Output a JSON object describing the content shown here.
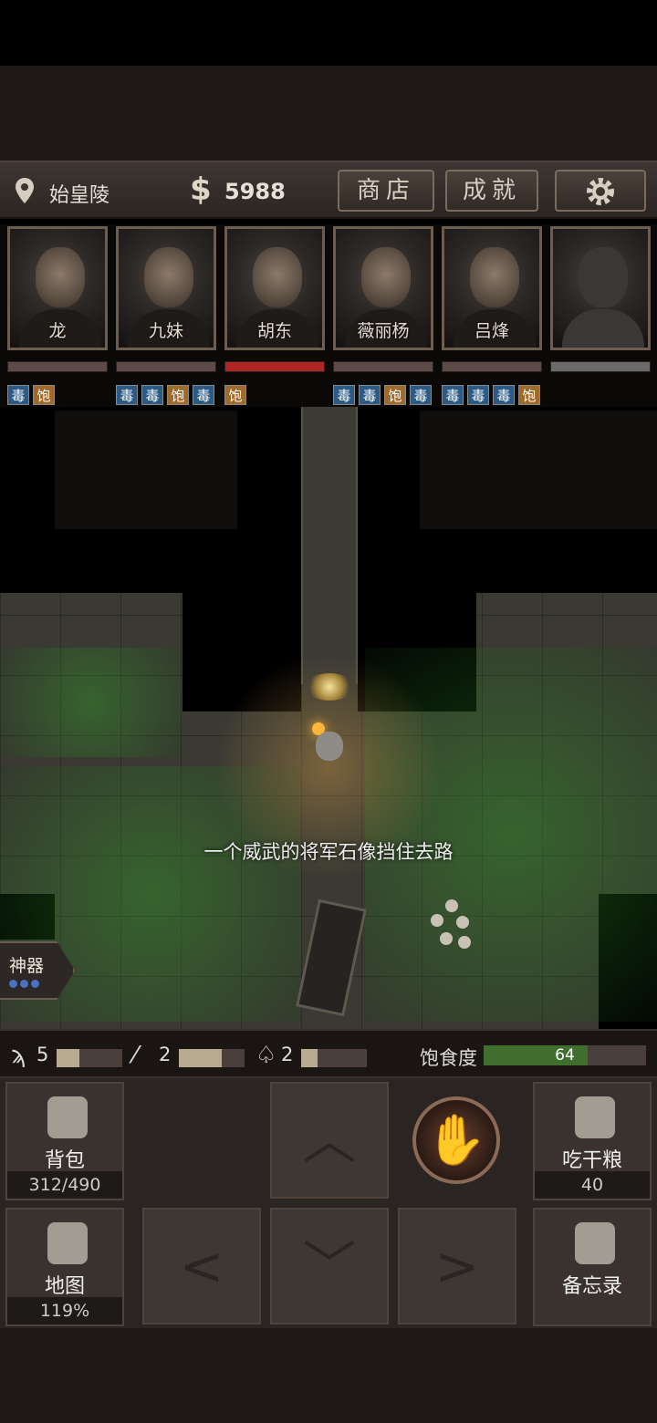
{
  "header": {
    "location": "始皇陵",
    "currency_symbol": "$",
    "money": "5988",
    "shop_label": "商店",
    "achievements_label": "成就"
  },
  "party": [
    {
      "name": "龙",
      "hp_color": "#5b4a48",
      "badges": [
        {
          "text": "毒",
          "kind": "poison"
        },
        {
          "text": "饱",
          "kind": "full"
        }
      ]
    },
    {
      "name": "九妹",
      "hp_color": "#5b4a48",
      "badges": [
        {
          "text": "毒",
          "kind": "poison"
        },
        {
          "text": "毒",
          "kind": "poison"
        },
        {
          "text": "饱",
          "kind": "full"
        },
        {
          "text": "毒",
          "kind": "poison"
        }
      ]
    },
    {
      "name": "胡东",
      "hp_color": "#b02424",
      "badges": [
        {
          "text": "饱",
          "kind": "full"
        }
      ]
    },
    {
      "name": "薇丽杨",
      "hp_color": "#5b4a48",
      "badges": [
        {
          "text": "毒",
          "kind": "poison"
        },
        {
          "text": "毒",
          "kind": "poison"
        },
        {
          "text": "饱",
          "kind": "full"
        },
        {
          "text": "毒",
          "kind": "poison"
        }
      ]
    },
    {
      "name": "吕烽",
      "hp_color": "#5b4a48",
      "badges": [
        {
          "text": "毒",
          "kind": "poison"
        },
        {
          "text": "毒",
          "kind": "poison"
        },
        {
          "text": "毒",
          "kind": "poison"
        },
        {
          "text": "饱",
          "kind": "full"
        }
      ]
    },
    {
      "name": "",
      "hp_color": "#6a6a6a",
      "badges": []
    }
  ],
  "map": {
    "message": "一个威武的将军石像挡住去路",
    "artifact_label": "神器"
  },
  "tools": {
    "torch_count": "5",
    "torch_level": 0.35,
    "rope_count": "2",
    "rope_level": 0.65,
    "shovel_count": "2",
    "shovel_level": 0.25
  },
  "satiety": {
    "label": "饱食度",
    "value": "64",
    "level": 0.64
  },
  "controls": {
    "backpack_label": "背包",
    "backpack_value": "312/490",
    "eat_label": "吃干粮",
    "eat_value": "40",
    "map_label": "地图",
    "map_value": "119%",
    "memo_label": "备忘录",
    "arrow_up": "︿",
    "arrow_left": "<",
    "arrow_down": "﹀",
    "arrow_right": ">",
    "hand_icon": "hand-icon"
  }
}
